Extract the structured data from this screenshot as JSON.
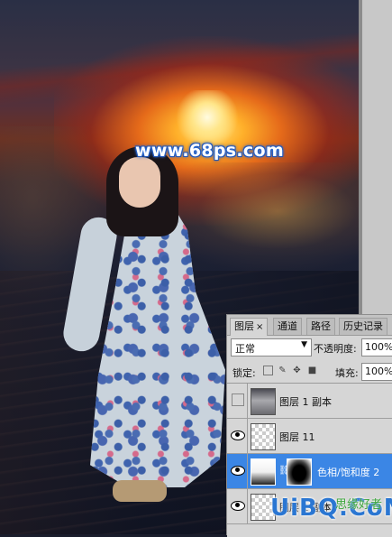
{
  "watermark_top": "www.68ps.com",
  "panel": {
    "tabs": [
      {
        "label": "图层",
        "close": "×"
      },
      {
        "label": "通道"
      },
      {
        "label": "路径"
      },
      {
        "label": "历史记录"
      }
    ],
    "blend_mode": "正常",
    "opacity_label": "不透明度:",
    "opacity_value": "100%",
    "lock_label": "锁定:",
    "fill_label": "填充:",
    "fill_value": "100%",
    "layers": [
      {
        "name": "图层 1 副本",
        "visible": false,
        "thumb": "photo",
        "selected": false
      },
      {
        "name": "图层 11",
        "visible": true,
        "thumb": "checker",
        "selected": false
      },
      {
        "name": "色相/饱和度 2",
        "visible": true,
        "thumb": "adjust",
        "selected": true
      },
      {
        "name": "图层 1 副本",
        "visible": true,
        "thumb": "checker",
        "selected": false
      }
    ]
  },
  "watermark_bottom": "UiBQ.CoM",
  "watermark_bottom_sub": "思缘好者"
}
